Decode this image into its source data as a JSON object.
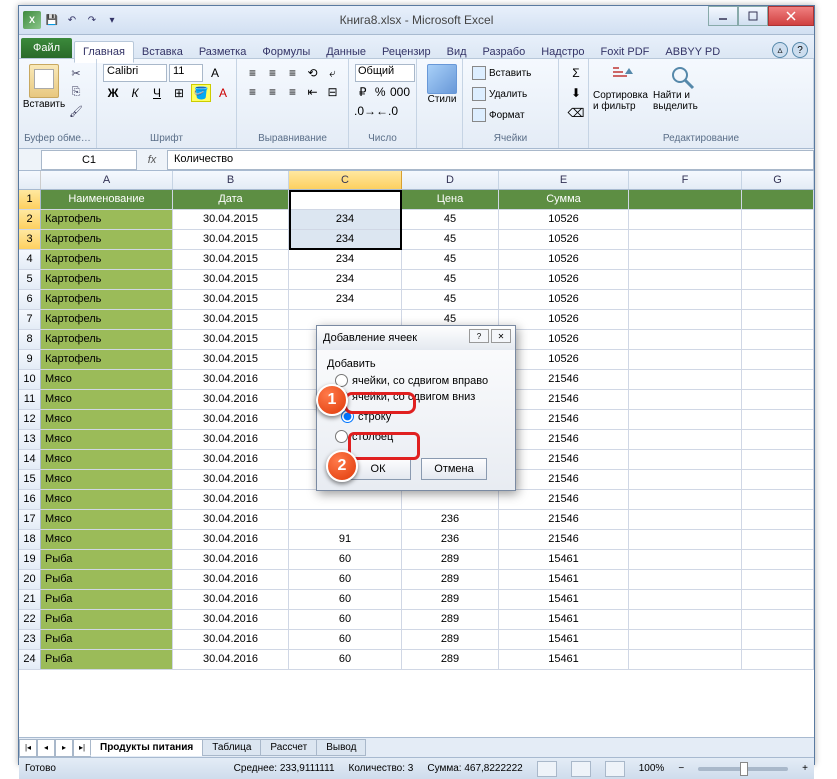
{
  "title": "Книга8.xlsx - Microsoft Excel",
  "tabs": {
    "file": "Файл",
    "list": [
      "Главная",
      "Вставка",
      "Разметка",
      "Формулы",
      "Данные",
      "Рецензир",
      "Вид",
      "Разрабо",
      "Надстро",
      "Foxit PDF",
      "ABBYY PD"
    ],
    "active": 0
  },
  "ribbon": {
    "clipboard": {
      "paste": "Вставить",
      "label": "Буфер обме…"
    },
    "font": {
      "name": "Calibri",
      "size": "11",
      "label": "Шрифт"
    },
    "align": {
      "label": "Выравнивание"
    },
    "number": {
      "format": "Общий",
      "label": "Число"
    },
    "styles": {
      "btn": "Стили",
      "label": ""
    },
    "cells": {
      "insert": "Вставить",
      "delete": "Удалить",
      "format": "Формат",
      "label": "Ячейки"
    },
    "editing": {
      "sort": "Сортировка и фильтр",
      "find": "Найти и выделить",
      "label": "Редактирование"
    }
  },
  "namebox": "C1",
  "formula": "Количество",
  "cols": [
    "A",
    "B",
    "C",
    "D",
    "E",
    "F",
    "G"
  ],
  "rows": [
    {
      "n": 1,
      "header": true,
      "c": [
        "Наименование",
        "Дата",
        "Количество",
        "Цена",
        "Сумма",
        "",
        ""
      ]
    },
    {
      "n": 2,
      "c": [
        "Картофель",
        "30.04.2015",
        "234",
        "45",
        "10526",
        "",
        ""
      ]
    },
    {
      "n": 3,
      "c": [
        "Картофель",
        "30.04.2015",
        "234",
        "45",
        "10526",
        "",
        ""
      ]
    },
    {
      "n": 4,
      "c": [
        "Картофель",
        "30.04.2015",
        "234",
        "45",
        "10526",
        "",
        ""
      ]
    },
    {
      "n": 5,
      "c": [
        "Картофель",
        "30.04.2015",
        "234",
        "45",
        "10526",
        "",
        ""
      ]
    },
    {
      "n": 6,
      "c": [
        "Картофель",
        "30.04.2015",
        "234",
        "45",
        "10526",
        "",
        ""
      ]
    },
    {
      "n": 7,
      "c": [
        "Картофель",
        "30.04.2015",
        "",
        "45",
        "10526",
        "",
        ""
      ]
    },
    {
      "n": 8,
      "c": [
        "Картофель",
        "30.04.2015",
        "",
        "",
        "10526",
        "",
        ""
      ]
    },
    {
      "n": 9,
      "c": [
        "Картофель",
        "30.04.2015",
        "",
        "",
        "10526",
        "",
        ""
      ]
    },
    {
      "n": 10,
      "c": [
        "Мясо",
        "30.04.2016",
        "",
        "",
        "21546",
        "",
        ""
      ]
    },
    {
      "n": 11,
      "c": [
        "Мясо",
        "30.04.2016",
        "",
        "",
        "21546",
        "",
        ""
      ]
    },
    {
      "n": 12,
      "c": [
        "Мясо",
        "30.04.2016",
        "",
        "",
        "21546",
        "",
        ""
      ]
    },
    {
      "n": 13,
      "c": [
        "Мясо",
        "30.04.2016",
        "",
        "",
        "21546",
        "",
        ""
      ]
    },
    {
      "n": 14,
      "c": [
        "Мясо",
        "30.04.2016",
        "",
        "",
        "21546",
        "",
        ""
      ]
    },
    {
      "n": 15,
      "c": [
        "Мясо",
        "30.04.2016",
        "",
        "",
        "21546",
        "",
        ""
      ]
    },
    {
      "n": 16,
      "c": [
        "Мясо",
        "30.04.2016",
        "",
        "",
        "21546",
        "",
        ""
      ]
    },
    {
      "n": 17,
      "c": [
        "Мясо",
        "30.04.2016",
        "",
        "236",
        "21546",
        "",
        ""
      ]
    },
    {
      "n": 18,
      "c": [
        "Мясо",
        "30.04.2016",
        "91",
        "236",
        "21546",
        "",
        ""
      ]
    },
    {
      "n": 19,
      "c": [
        "Рыба",
        "30.04.2016",
        "60",
        "289",
        "15461",
        "",
        ""
      ]
    },
    {
      "n": 20,
      "c": [
        "Рыба",
        "30.04.2016",
        "60",
        "289",
        "15461",
        "",
        ""
      ]
    },
    {
      "n": 21,
      "c": [
        "Рыба",
        "30.04.2016",
        "60",
        "289",
        "15461",
        "",
        ""
      ]
    },
    {
      "n": 22,
      "c": [
        "Рыба",
        "30.04.2016",
        "60",
        "289",
        "15461",
        "",
        ""
      ]
    },
    {
      "n": 23,
      "c": [
        "Рыба",
        "30.04.2016",
        "60",
        "289",
        "15461",
        "",
        ""
      ]
    },
    {
      "n": 24,
      "c": [
        "Рыба",
        "30.04.2016",
        "60",
        "289",
        "15461",
        "",
        ""
      ]
    }
  ],
  "selection": {
    "col": "C",
    "rows_sel": [
      1,
      2,
      3
    ]
  },
  "sheets": {
    "active": "Продукты питания",
    "list": [
      "Продукты питания",
      "Таблица",
      "Рассчет",
      "Вывод"
    ]
  },
  "status": {
    "ready": "Готово",
    "avg_lbl": "Среднее:",
    "avg": "233,9111111",
    "cnt_lbl": "Количество:",
    "cnt": "3",
    "sum_lbl": "Сумма:",
    "sum": "467,8222222",
    "zoom": "100%"
  },
  "dialog": {
    "title": "Добавление ячеек",
    "group": "Добавить",
    "opts": [
      "ячейки, со сдвигом вправо",
      "ячейки, со сдвигом вниз",
      "строку",
      "столбец"
    ],
    "selected": 2,
    "ok": "ОК",
    "cancel": "Отмена"
  },
  "markers": {
    "m1": "1",
    "m2": "2"
  }
}
